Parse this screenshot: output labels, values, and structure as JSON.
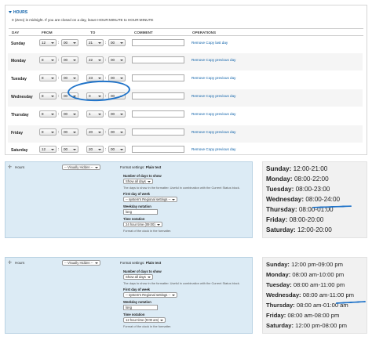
{
  "hours": {
    "legend": "HOURS",
    "description": "0 (Zero) is midnight. If you are closed on a day, leave HOUR:MINUTE to HOUR:MINUTE",
    "columns": [
      "DAY",
      "FROM",
      "TO",
      "COMMENT",
      "OPERATIONS"
    ],
    "rows": [
      {
        "day": "Sunday",
        "from_h": "12",
        "from_m": "00",
        "to_h": "21",
        "to_m": "00",
        "ops": "Remove Copy last day"
      },
      {
        "day": "Monday",
        "from_h": "8",
        "from_m": "00",
        "to_h": "22",
        "to_m": "00",
        "ops": "Remove Copy previous day"
      },
      {
        "day": "Tuesday",
        "from_h": "8",
        "from_m": "00",
        "to_h": "23",
        "to_m": "00",
        "ops": "Remove Copy previous day"
      },
      {
        "day": "Wednesday",
        "from_h": "8",
        "from_m": "00",
        "to_h": "0",
        "to_m": "00",
        "ops": "Remove Copy previous day"
      },
      {
        "day": "Thursday",
        "from_h": "8",
        "from_m": "00",
        "to_h": "1",
        "to_m": "00",
        "ops": "Remove Copy previous day"
      },
      {
        "day": "Friday",
        "from_h": "8",
        "from_m": "00",
        "to_h": "20",
        "to_m": "00",
        "ops": "Remove Copy previous day"
      },
      {
        "day": "Saturday",
        "from_h": "12",
        "from_m": "00",
        "to_h": "20",
        "to_m": "00",
        "ops": "Remove Copy previous day"
      }
    ]
  },
  "config_mid": {
    "label": "Hours",
    "visibility": "-- Visually Hidden --",
    "format_settings_prefix": "Format settings:",
    "format_settings_value": "Plain text",
    "days_label": "Number of days to show",
    "days_value": "Show all days",
    "days_help": "The days to show in the formatter. Useful in combination with the Current Status block.",
    "first_day_label": "First day of week",
    "first_day_value": "-- system's Regional settings --",
    "weekday_label": "Weekday notation",
    "weekday_value": "long",
    "time_label": "Time notation",
    "time_value": "24 hour time (09:00)",
    "time_help": "Format of the clock in the formatter."
  },
  "config_bot": {
    "label": "Hours",
    "visibility": "-- Visually Hidden --",
    "format_settings_prefix": "Format settings:",
    "format_settings_value": "Plain text",
    "days_label": "Number of days to show",
    "days_value": "Show all days",
    "days_help": "The days to show in the formatter. Useful in combination with the Current Status block.",
    "first_day_label": "First day of week",
    "first_day_value": "-- system's Regional settings --",
    "weekday_label": "Weekday notation",
    "weekday_value": "long",
    "time_label": "Time notation",
    "time_value": "12 hour time (9:00 am)",
    "time_help": "Format of the clock in the formatter."
  },
  "output_24h": [
    {
      "day": "Sunday:",
      "time": "12:00-21:00"
    },
    {
      "day": "Monday:",
      "time": "08:00-22:00"
    },
    {
      "day": "Tuesday:",
      "time": "08:00-23:00"
    },
    {
      "day": "Wednesday:",
      "time": "08:00-24:00"
    },
    {
      "day": "Thursday:",
      "time": "08:00-01:00"
    },
    {
      "day": "Friday:",
      "time": "08:00-20:00"
    },
    {
      "day": "Saturday:",
      "time": "12:00-20:00"
    }
  ],
  "output_12h": [
    {
      "day": "Sunday:",
      "time": "12:00 pm-09:00 pm"
    },
    {
      "day": "Monday:",
      "time": "08:00 am-10:00 pm"
    },
    {
      "day": "Tuesday:",
      "time": "08:00 am-11:00 pm"
    },
    {
      "day": "Wednesday:",
      "time": "08:00 am-11:00 pm"
    },
    {
      "day": "Thursday:",
      "time": "08:00 am-01:00 am"
    },
    {
      "day": "Friday:",
      "time": "08:00 am-08:00 pm"
    },
    {
      "day": "Saturday:",
      "time": "12:00 pm-08:00 pm"
    }
  ],
  "colors": {
    "link": "#0a5fa8",
    "annotation": "#1f73c9",
    "panel": "#dcebf5"
  }
}
